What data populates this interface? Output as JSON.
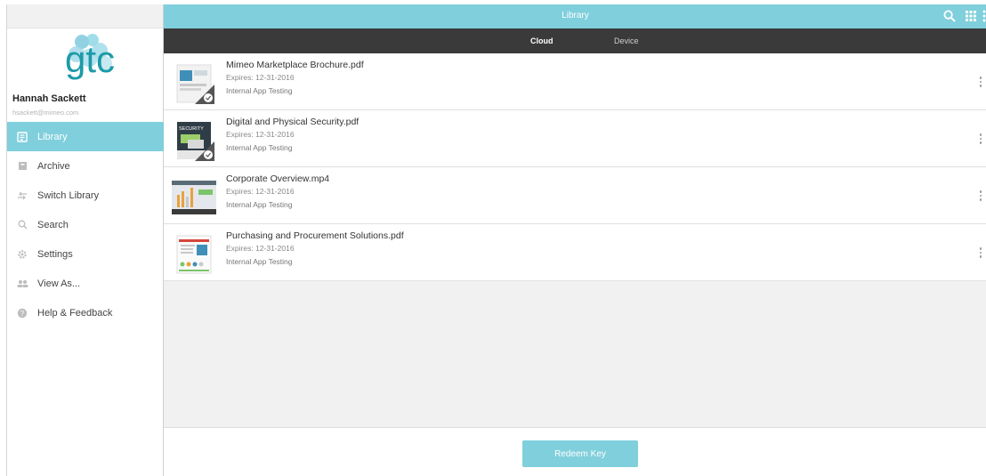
{
  "header": {
    "title": "Library"
  },
  "tabs": [
    {
      "label": "Cloud",
      "active": true
    },
    {
      "label": "Device",
      "active": false
    }
  ],
  "user": {
    "name": "Hannah Sackett",
    "email": "hsackett@mimeo.com"
  },
  "logo": {
    "text": "gtc"
  },
  "sidebar": {
    "items": [
      {
        "label": "Library",
        "icon": "library-icon",
        "active": true
      },
      {
        "label": "Archive",
        "icon": "archive-icon"
      },
      {
        "label": "Switch Library",
        "icon": "switch-icon"
      },
      {
        "label": "Search",
        "icon": "search-icon"
      },
      {
        "label": "Settings",
        "icon": "gear-icon"
      },
      {
        "label": "View As...",
        "icon": "people-icon"
      },
      {
        "label": "Help & Feedback",
        "icon": "help-icon"
      }
    ]
  },
  "documents": [
    {
      "name": "Mimeo Marketplace Brochure.pdf",
      "expires": "Expires: 12-31-2016",
      "group": "Internal App Testing",
      "downloaded": true
    },
    {
      "name": "Digital and Physical Security.pdf",
      "expires": "Expires: 12-31-2016",
      "group": "Internal App Testing",
      "downloaded": true,
      "thumb_text": "SECURITY"
    },
    {
      "name": "Corporate Overview.mp4",
      "expires": "Expires: 12-31-2016",
      "group": "Internal App Testing",
      "downloaded": false
    },
    {
      "name": "Purchasing and Procurement Solutions.pdf",
      "expires": "Expires: 12-31-2016",
      "group": "Internal App Testing",
      "downloaded": false
    }
  ],
  "footer": {
    "redeem_label": "Redeem Key"
  },
  "colors": {
    "accent": "#80cfdc",
    "tabbar": "#3a3a3a",
    "background": "#f1f1f1"
  }
}
